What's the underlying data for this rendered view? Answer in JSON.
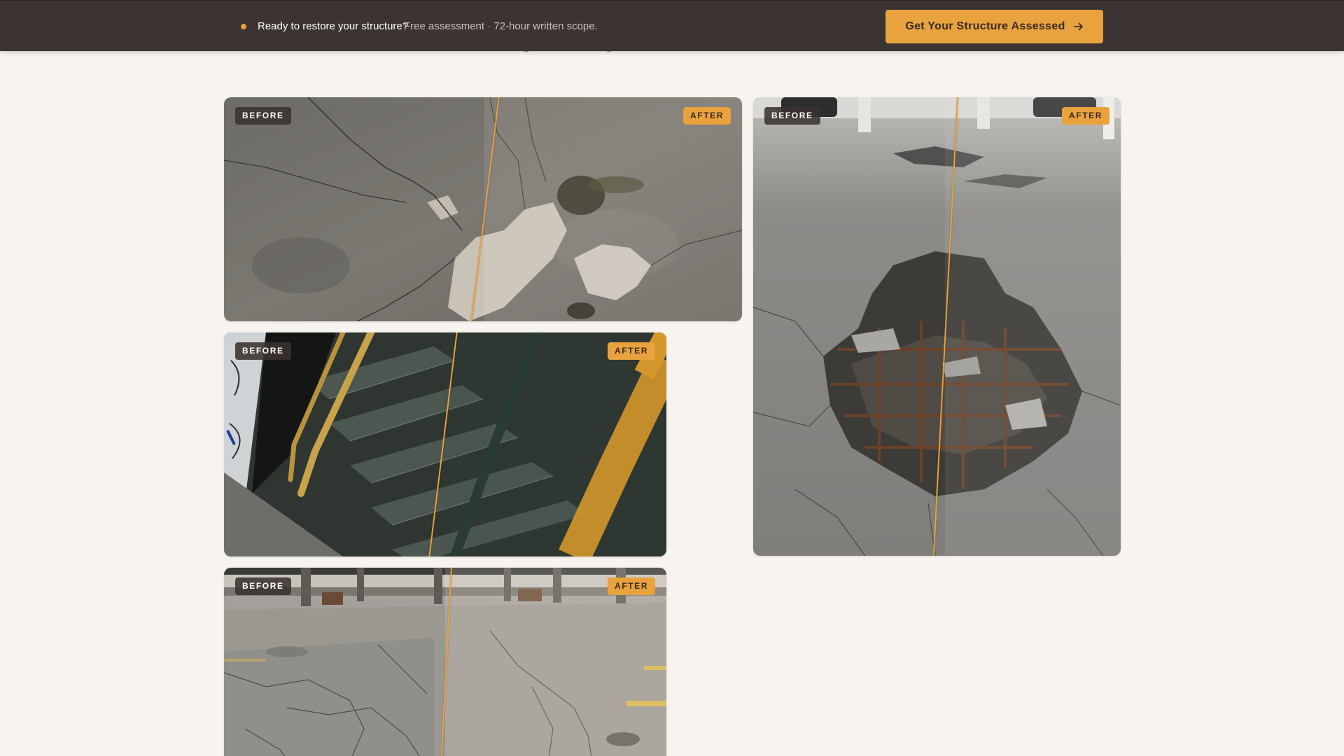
{
  "banner": {
    "title": "Ready to restore your structure?",
    "subtitle": "Free assessment · 72-hour written scope.",
    "cta_label": "Get Your Structure Assessed",
    "cta_icon": "arrow-right-icon",
    "accent_color": "#e8a23e",
    "background_color": "#3c3432"
  },
  "gallery": {
    "before_label": "BEFORE",
    "after_label": "AFTER",
    "items": [
      {
        "subject": "cracked spalled concrete slab with oil stain"
      },
      {
        "subject": "parking deck slab with exposed rebar pothole"
      },
      {
        "subject": "weathered stairwell with yellow handrail"
      },
      {
        "subject": "cracked parking garage floor"
      }
    ]
  }
}
